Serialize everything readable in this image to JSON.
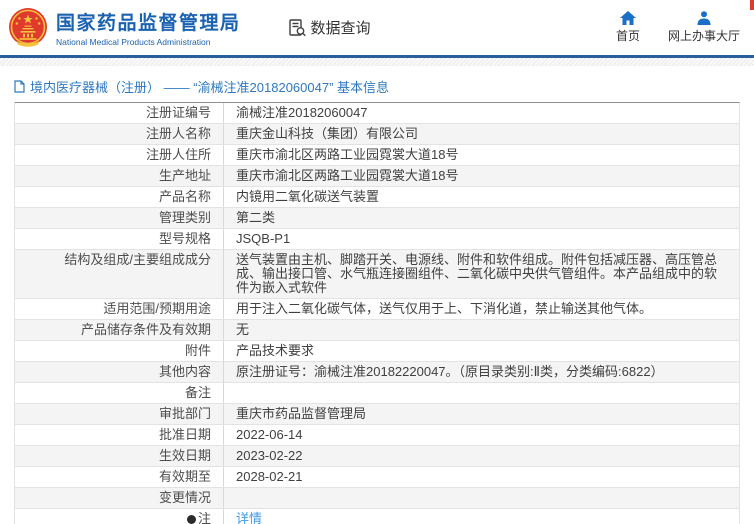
{
  "header": {
    "agency_name_cn": "国家药品监督管理局",
    "agency_name_en": "National Medical Products Administration",
    "data_query_label": "数据查询",
    "nav_items": [
      {
        "label": "首页",
        "icon": "home-icon"
      },
      {
        "label": "网上办事大厅",
        "icon": "person-icon"
      }
    ]
  },
  "breadcrumb": {
    "text": "境内医疗器械（注册） —— “渝械注准20182060047” 基本信息"
  },
  "table": {
    "rows": [
      {
        "label": "注册证编号",
        "value": "渝械注准20182060047"
      },
      {
        "label": "注册人名称",
        "value": "重庆金山科技（集团）有限公司"
      },
      {
        "label": "注册人住所",
        "value": "重庆市渝北区两路工业园霓裳大道18号"
      },
      {
        "label": "生产地址",
        "value": "重庆市渝北区两路工业园霓裳大道18号"
      },
      {
        "label": "产品名称",
        "value": "内镜用二氧化碳送气装置"
      },
      {
        "label": "管理类别",
        "value": "第二类"
      },
      {
        "label": "型号规格",
        "value": "JSQB-P1"
      },
      {
        "label": "结构及组成/主要组成成分",
        "value": "送气装置由主机、脚踏开关、电源线、附件和软件组成。附件包括减压器、高压管总成、输出接口管、水气瓶连接圈组件、二氧化碳中央供气管组件。本产品组成中的软件为嵌入式软件"
      },
      {
        "label": "适用范围/预期用途",
        "value": "用于注入二氧化碳气体，送气仅用于上、下消化道，禁止输送其他气体。"
      },
      {
        "label": "产品储存条件及有效期",
        "value": "无"
      },
      {
        "label": "附件",
        "value": "产品技术要求"
      },
      {
        "label": "其他内容",
        "value": "原注册证号：渝械注准20182220047。（原目录类别:Ⅱ类，分类编码:6822）"
      },
      {
        "label": "备注",
        "value": ""
      },
      {
        "label": "审批部门",
        "value": "重庆市药品监督管理局"
      },
      {
        "label": "批准日期",
        "value": "2022-06-14"
      },
      {
        "label": "生效日期",
        "value": "2023-02-22"
      },
      {
        "label": "有效期至",
        "value": "2028-02-21"
      },
      {
        "label": "变更情况",
        "value": ""
      },
      {
        "label": "注",
        "label_icon": "note-balloon-icon",
        "value": "详情",
        "link": true
      }
    ]
  },
  "colors": {
    "brand_blue": "#1b62b1",
    "nav_icon_blue": "#1b6fc6",
    "divider_blue": "#2b5f9c",
    "breadcrumb_blue": "#2e79c0",
    "link_blue": "#3d9ae8",
    "row_alt_bg": "#f4f4f4",
    "emblem_red": "#e0392e",
    "emblem_gold": "#f6c33e"
  }
}
